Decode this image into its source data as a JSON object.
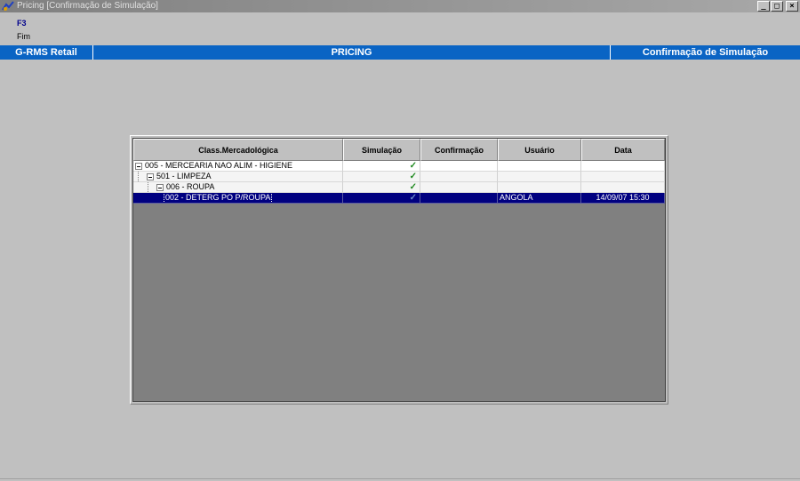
{
  "window": {
    "title": "Pricing [Confirmação de Simulação]",
    "minimize": "_",
    "maximize": "□",
    "close": "×"
  },
  "function_key": {
    "key": "F3",
    "label": "Fim"
  },
  "header": {
    "left": "G-RMS Retail",
    "center": "PRICING",
    "right": "Confirmação de Simulação"
  },
  "grid": {
    "columns": [
      "Class.Mercadológica",
      "Simulação",
      "Confirmação",
      "Usuário",
      "Data"
    ],
    "rows": [
      {
        "class": "005 - MERCEARIA NAO ALIM - HIGIENE",
        "simulacao": "✓",
        "confirmacao": "",
        "usuario": "",
        "data": ""
      },
      {
        "class": "501 - LIMPEZA",
        "simulacao": "✓",
        "confirmacao": "",
        "usuario": "",
        "data": ""
      },
      {
        "class": "006 - ROUPA",
        "simulacao": "✓",
        "confirmacao": "",
        "usuario": "",
        "data": ""
      },
      {
        "class": "002 - DETERG PO P/ROUPA",
        "simulacao": "✓",
        "confirmacao": "",
        "usuario": "ANGOLA",
        "data": "14/09/07 15:30"
      }
    ]
  },
  "colors": {
    "header_blue": "#0a64c4",
    "selected_row": "#000080",
    "check_green": "#228b22"
  }
}
